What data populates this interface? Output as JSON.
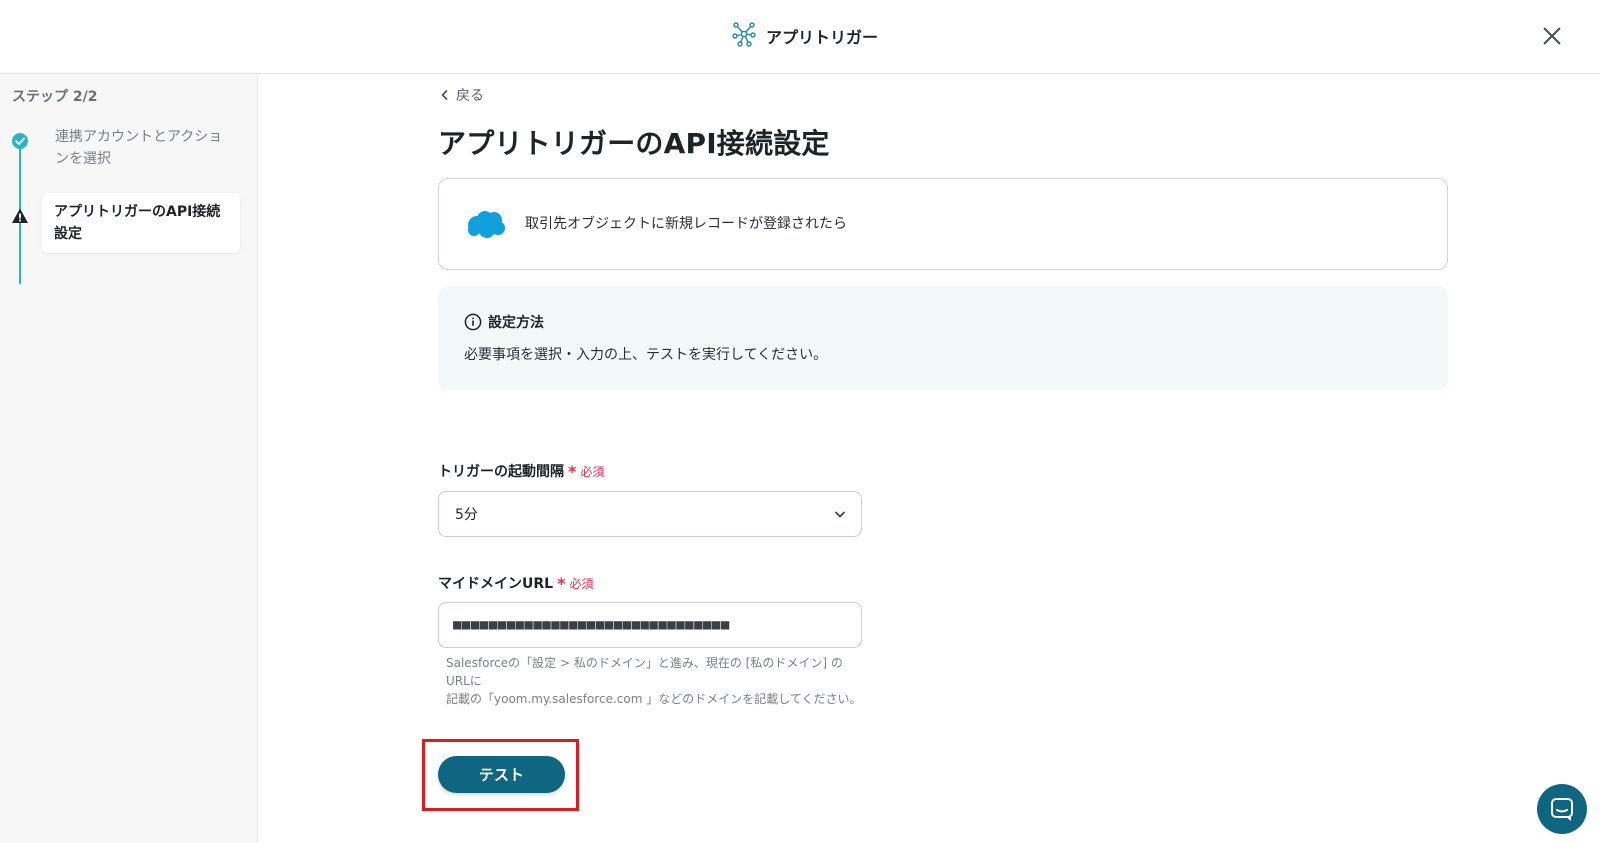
{
  "header": {
    "title": "アプリトリガー",
    "app_icon": "network-nodes-icon",
    "close_icon": "close-icon"
  },
  "sidebar": {
    "step_count": "ステップ 2/2",
    "steps": [
      {
        "label": "連携アカウントとアクションを選択",
        "status": "done"
      },
      {
        "label": "アプリトリガーのAPI接続設定",
        "status": "warning"
      }
    ]
  },
  "main": {
    "back_label": "戻る",
    "page_title": "アプリトリガーのAPI接続設定",
    "trigger": {
      "icon": "salesforce-cloud-icon",
      "label": "取引先オブジェクトに新規レコードが登録されたら"
    },
    "info": {
      "title": "設定方法",
      "body": "必要事項を選択・入力の上、テストを実行してください。"
    },
    "interval_field": {
      "label": "トリガーの起動間隔",
      "required_mark": "*",
      "required_text": "必須",
      "value": "5分"
    },
    "domain_field": {
      "label": "マイドメインURL",
      "required_mark": "*",
      "required_text": "必須",
      "value": "■■■■■■■■■■■■■■■■■■■■■■■■■■■■■■■",
      "help_line1": "Salesforceの「設定 > 私のドメイン」と進み、現在の [私のドメイン] の URLに",
      "help_line2": "記載の「yoom.my.salesforce.com 」などのドメインを記載してください。"
    },
    "test_button": "テスト"
  },
  "colors": {
    "accent": "#0e6680",
    "step_line": "#2bb4c2",
    "required": "#e0324b",
    "highlight": "#d81e1e",
    "info_bg": "#f2f9f8"
  },
  "chat_fab_icon": "chat-bubble-icon"
}
